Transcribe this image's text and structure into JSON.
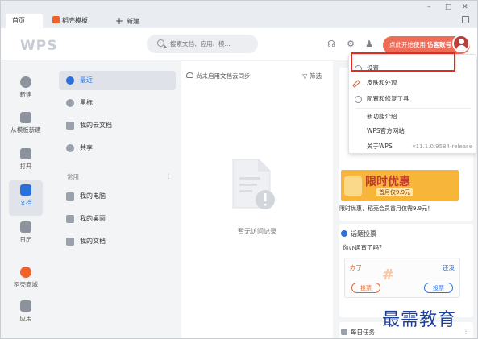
{
  "tabs": [
    {
      "label": "首页"
    },
    {
      "label": "稻壳模板"
    }
  ],
  "new_tab_label": "新建",
  "window_controls": {
    "minimize": "–",
    "maximize": "□",
    "close": "✕"
  },
  "header": {
    "logo": "WPS",
    "search_placeholder": "搜索文档、应用、模...",
    "trial_text": "点此开始使用",
    "trial_account": "访客账号"
  },
  "nav": [
    {
      "label": "新建",
      "icon": "plus-circle-icon"
    },
    {
      "label": "从模板新建",
      "icon": "template-icon"
    },
    {
      "label": "打开",
      "icon": "folder-icon"
    },
    {
      "label": "文档",
      "icon": "document-icon",
      "active": true
    },
    {
      "label": "日历",
      "icon": "calendar-icon"
    },
    {
      "label": "稻壳商城",
      "icon": "shop-icon"
    },
    {
      "label": "应用",
      "icon": "apps-icon"
    }
  ],
  "mid": {
    "items": [
      {
        "label": "最近",
        "icon": "clock-icon",
        "active": true
      },
      {
        "label": "星标",
        "icon": "star-icon"
      },
      {
        "label": "我的云文档",
        "icon": "cloud-doc-icon"
      },
      {
        "label": "共享",
        "icon": "share-icon"
      }
    ],
    "group_title": "常用",
    "group_more": "⋮",
    "common": [
      {
        "label": "我的电脑",
        "icon": "computer-icon"
      },
      {
        "label": "我的桌面",
        "icon": "desktop-icon"
      },
      {
        "label": "我的文档",
        "icon": "folder-icon"
      }
    ]
  },
  "main": {
    "sync_tip": "尚未启用文档云同步",
    "filter": "筛选",
    "empty_text": "暂无访问记录"
  },
  "right": {
    "promo_big": "限时优惠",
    "promo_small": "首月仅9.9元",
    "promo_text": "限时优惠，稻壳会员首月仅需9.9元！",
    "vote_title": "话题投票",
    "vote_question": "你办通宵了吗？",
    "vote_a": "办了",
    "vote_b": "还没",
    "vote_btn": "投票",
    "daily_task": "每日任务",
    "more": "⋮"
  },
  "menu": {
    "items": [
      {
        "label": "设置",
        "icon": "gear-icon"
      },
      {
        "label": "皮肤和外观",
        "icon": "brush-icon"
      },
      {
        "label": "配置和修复工具",
        "icon": "wrench-icon"
      },
      {
        "label": "新功能介绍"
      },
      {
        "label": "WPS官方网站"
      },
      {
        "label": "关于WPS"
      }
    ],
    "version": "v11.1.0.9584-release"
  },
  "watermark": "最需教育",
  "colors": {
    "accent": "#2a6fdb",
    "trial": "#ef6d57",
    "highlight": "#e02b25"
  }
}
